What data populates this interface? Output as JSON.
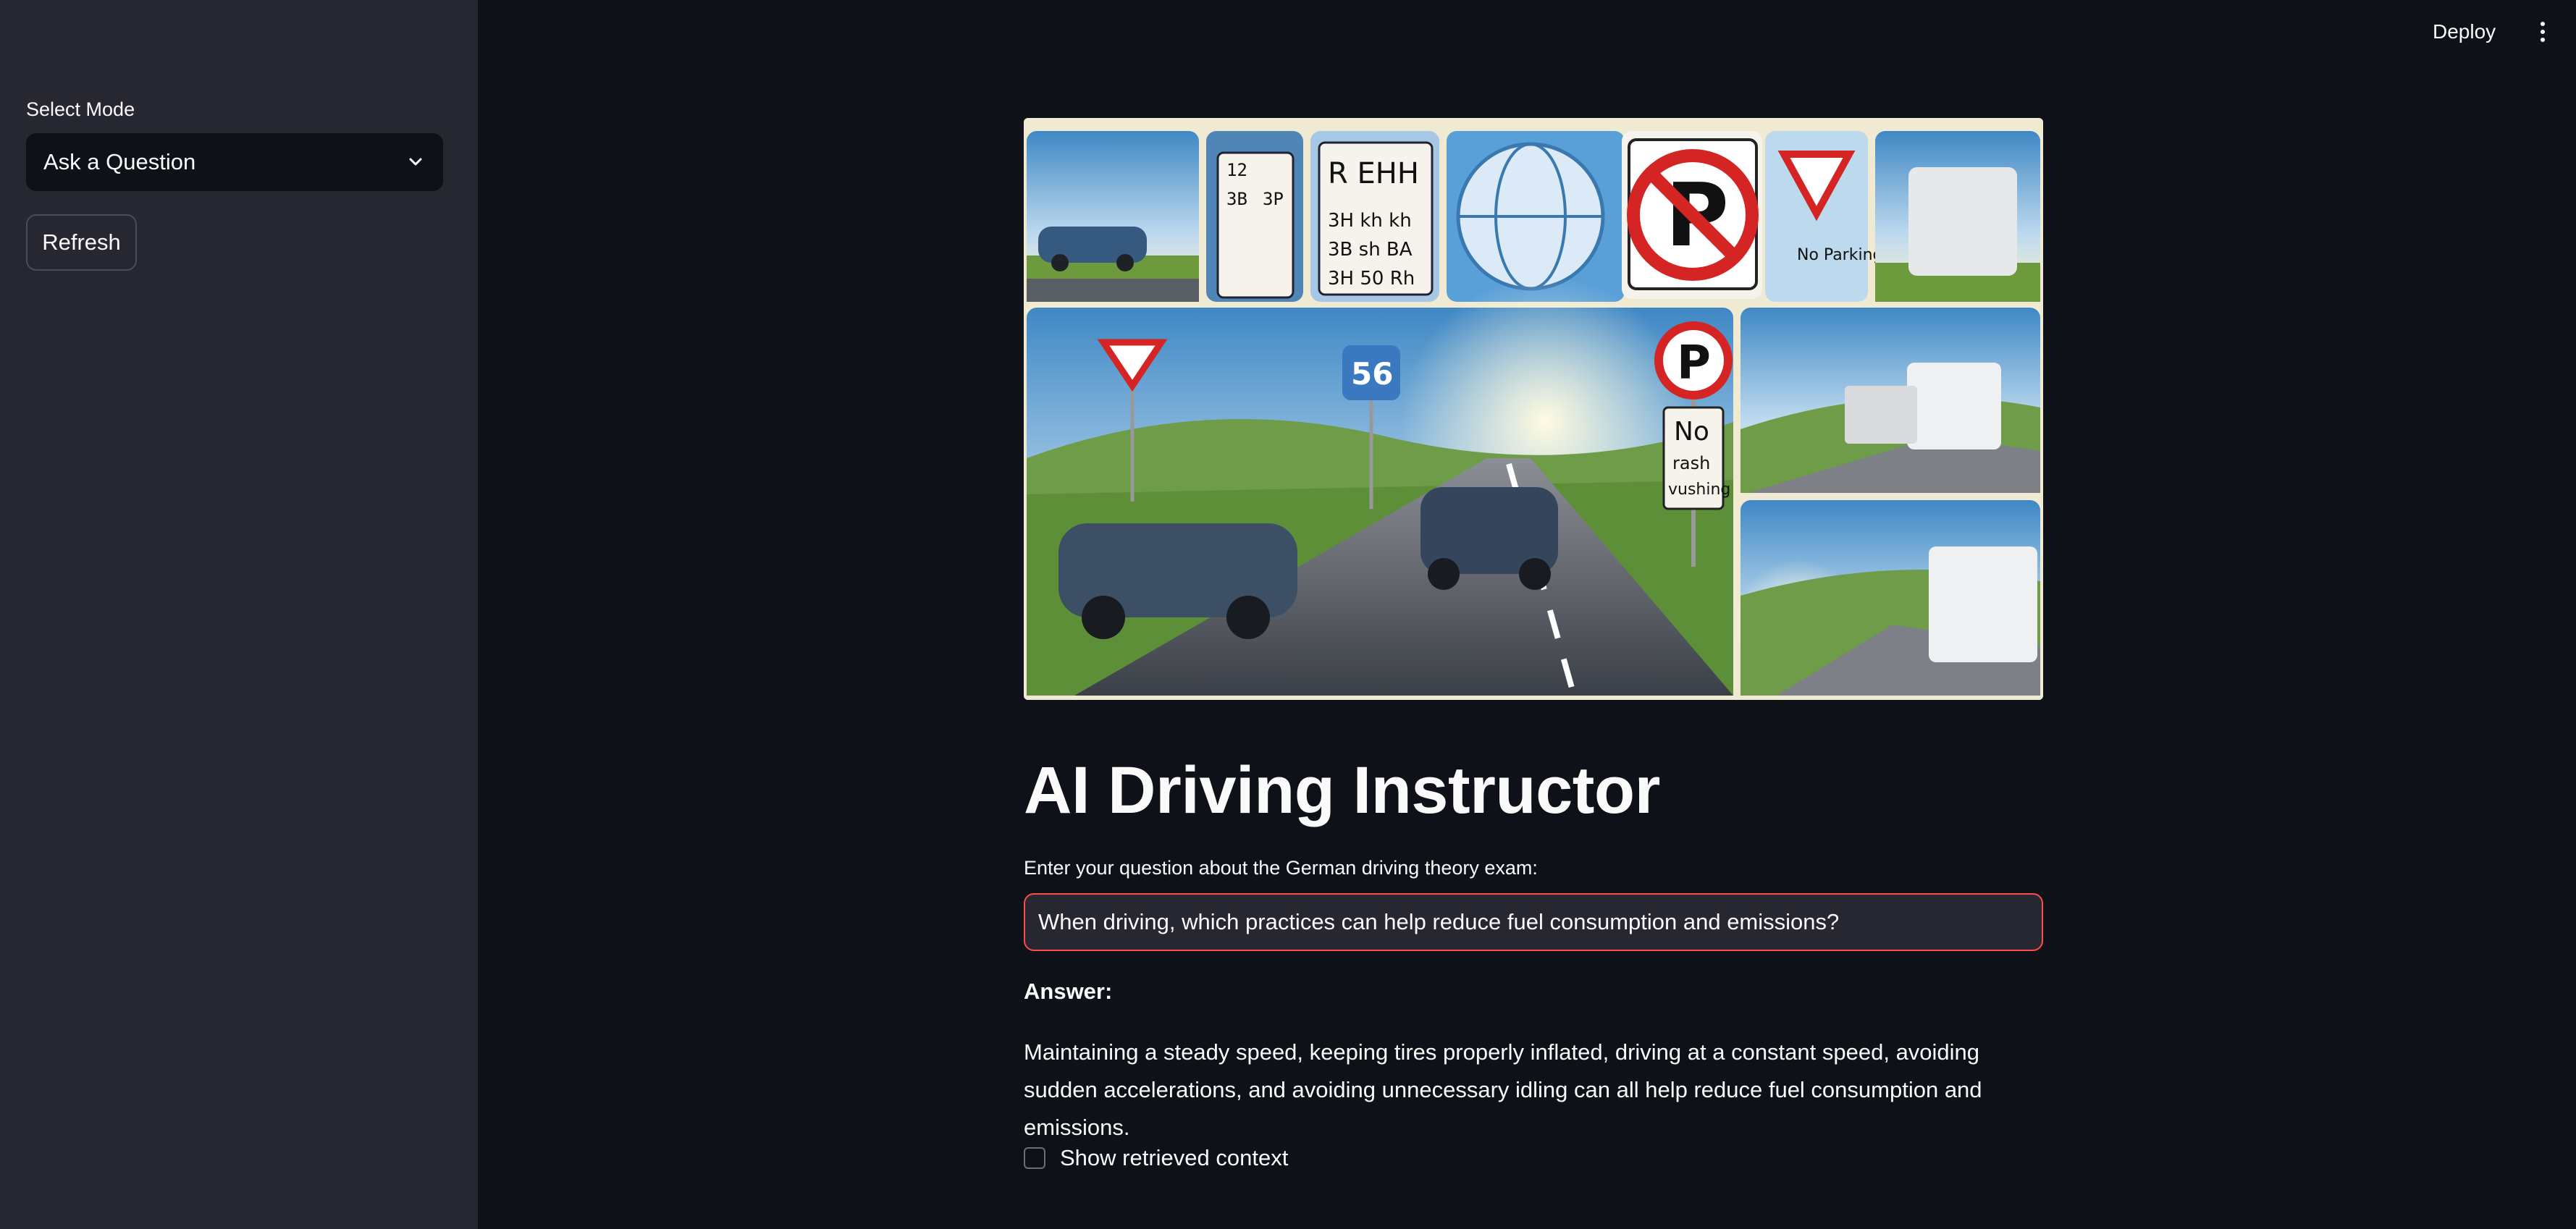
{
  "sidebar": {
    "mode_label": "Select Mode",
    "mode_value": "Ask a Question",
    "refresh_label": "Refresh"
  },
  "topbar": {
    "deploy_label": "Deploy",
    "menu_icon": "kebab-menu-icon"
  },
  "main": {
    "hero_image": {
      "sign_texts": [
        "12",
        "3B",
        "3P",
        "R EHH",
        "3H kh kh",
        "3B sh BA",
        "3H 50 Rh",
        "No Parking",
        "56",
        "No",
        "rash",
        "vushing"
      ]
    },
    "title": "AI Driving Instructor",
    "question_label": "Enter your question about the German driving theory exam:",
    "question_value": "When driving, which practices can help reduce fuel consumption and emissions?",
    "answer_label": "Answer:",
    "answer_text": "Maintaining a steady speed, keeping tires properly inflated, driving at a constant speed, avoiding sudden accelerations, and avoiding unnecessary idling can all help reduce fuel consumption and emissions.",
    "context_label": "Show retrieved context",
    "context_checked": false
  },
  "colors": {
    "background": "#0e1117",
    "sidebar": "#262730",
    "accent": "#ff4b4b",
    "text": "#fafafa"
  }
}
